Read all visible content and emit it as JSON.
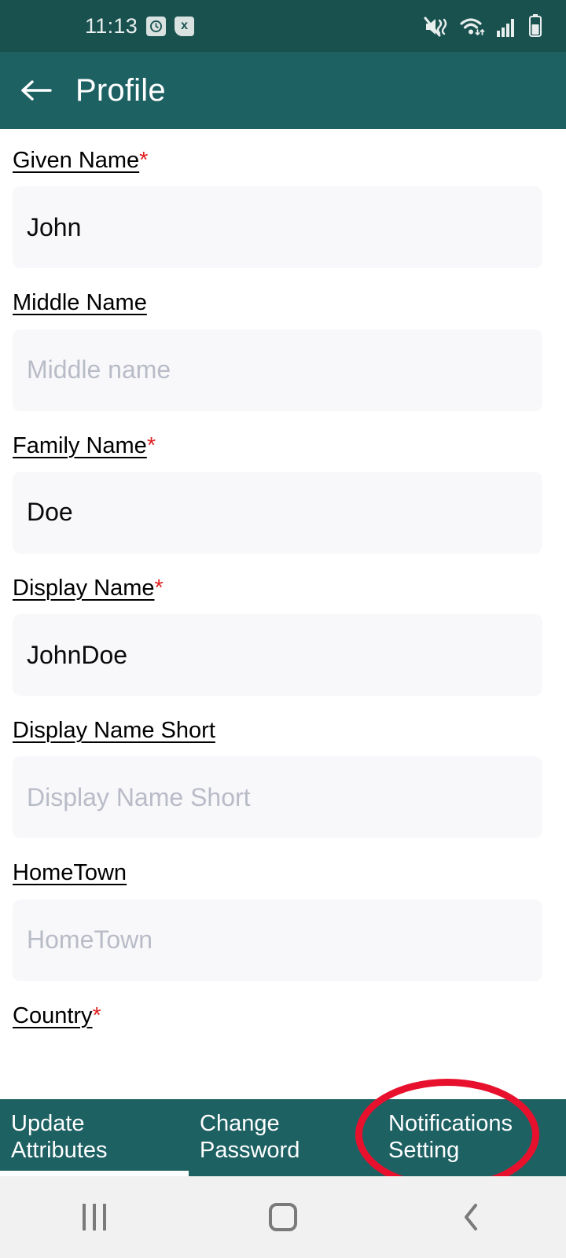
{
  "status_bar": {
    "time": "11:13",
    "alarm_badge": "alarm-icon",
    "sim_badge": "x",
    "icons": [
      "mute-vibrate-icon",
      "wifi-icon",
      "signal-bars-icon",
      "battery-icon"
    ],
    "colors": {
      "background": "#19514f",
      "foreground": "#e8eeed"
    }
  },
  "app_bar": {
    "back_icon": "back-arrow-icon",
    "title": "Profile",
    "color": "#1e6163"
  },
  "form": {
    "required_marker": "*",
    "fields": [
      {
        "label": "Given Name",
        "required": true,
        "value": "John",
        "placeholder": ""
      },
      {
        "label": "Middle Name",
        "required": false,
        "value": "",
        "placeholder": "Middle name"
      },
      {
        "label": "Family Name",
        "required": true,
        "value": "Doe",
        "placeholder": ""
      },
      {
        "label": "Display Name",
        "required": true,
        "value": "JohnDoe",
        "placeholder": ""
      },
      {
        "label": "Display Name Short",
        "required": false,
        "value": "",
        "placeholder": "Display Name Short"
      },
      {
        "label": "HomeTown",
        "required": false,
        "value": "",
        "placeholder": "HomeTown"
      },
      {
        "label": "Country",
        "required": true,
        "value": "",
        "placeholder": ""
      }
    ]
  },
  "tab_bar": {
    "active_index": 0,
    "tabs": [
      {
        "line1": "Update",
        "line2": "Attributes"
      },
      {
        "line1": "Change",
        "line2": "Password"
      },
      {
        "line1": "Notifications",
        "line2": "Setting"
      }
    ]
  },
  "navigation_bar": {
    "recents": "recents-icon",
    "home": "home-icon",
    "back": "back-icon"
  },
  "annotation": {
    "shape": "ellipse",
    "color": "#e8112d",
    "target": "Notifications Setting"
  }
}
